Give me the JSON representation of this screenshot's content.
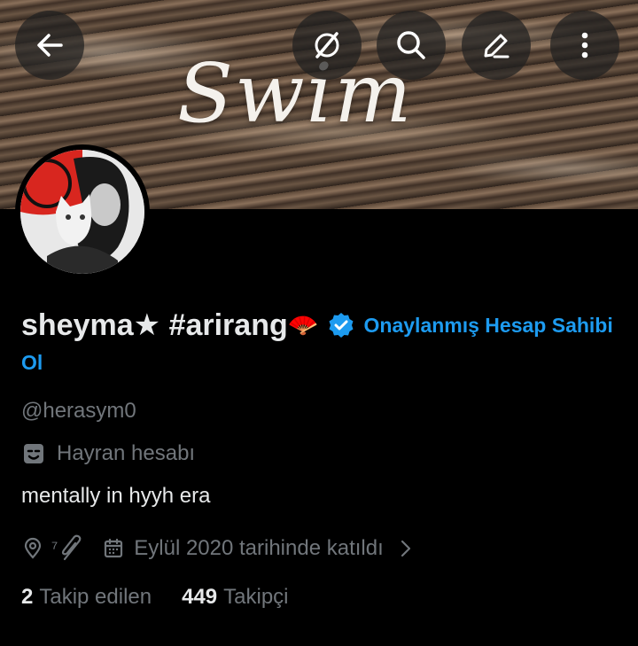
{
  "banner": {
    "title": "Swim"
  },
  "header": {
    "back_icon": "arrow-left-icon",
    "icons": [
      "grok-icon",
      "search-icon",
      "edit-icon",
      "more-vertical-icon"
    ]
  },
  "profile": {
    "display_name": "sheyma★ #arirang",
    "name_emoji": "🪭",
    "verify_text": "Onaylanmış Hesap Sahibi Ol",
    "handle": "@herasym0",
    "category_icon": "theater-masks-icon",
    "category": "Hayran hesabı",
    "bio": "mentally in hyyh era",
    "location": "⁷",
    "joined": "Eylül 2020 tarihinde katıldı"
  },
  "stats": {
    "following_count": "2",
    "following_label": "Takip edilen",
    "followers_count": "449",
    "followers_label": "Takipçi"
  },
  "colors": {
    "accent": "#1d9bf0",
    "muted": "#71767b",
    "text": "#e7e9ea",
    "background": "#000000"
  }
}
